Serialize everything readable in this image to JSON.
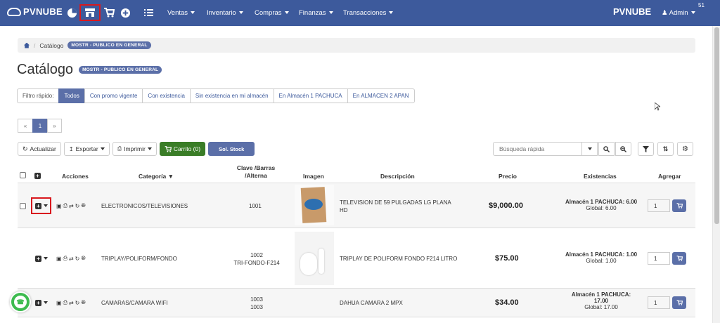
{
  "navbar": {
    "brand": "PVNUBE",
    "brand_right": "PVNUBE",
    "menus": [
      "Ventas",
      "Inventario",
      "Compras",
      "Finanzas",
      "Transacciones"
    ],
    "user": "Admin",
    "corner_number": "51",
    "icons": [
      "pie-chart-icon",
      "store-icon",
      "cart-icon",
      "plus-circle-icon",
      "list-icon"
    ]
  },
  "breadcrumb": {
    "current": "Catálogo",
    "badge": "MOSTR - PUBLICO EN GENERAL"
  },
  "page": {
    "title": "Catálogo",
    "badge": "MOSTR - PUBLICO EN GENERAL"
  },
  "filters": {
    "label": "Filtro rápido:",
    "options": [
      "Todos",
      "Con promo vigente",
      "Con existencia",
      "Sin existencia en mi almacén",
      "En Almacén 1 PACHUCA",
      "En ALMACEN 2 APAN"
    ],
    "active": "Todos"
  },
  "pager": {
    "prev": "«",
    "page": "1",
    "next": "»"
  },
  "toolbar": {
    "refresh": "Actualizar",
    "export": "Exportar",
    "print": "Imprimir",
    "cart": "Carrito (0)",
    "stock": "Sol. Stock",
    "search_placeholder": "Búsqueda rápida"
  },
  "table": {
    "headers": {
      "actions": "Acciones",
      "category": "Categoría",
      "code1": "Clave /Barras",
      "code2": "/Alterna",
      "image": "Imagen",
      "description": "Descripción",
      "price": "Precio",
      "stock": "Existencias",
      "add": "Agregar"
    },
    "rows": [
      {
        "category": "ELECTRONICOS/TELEVISIONES",
        "code": "1001",
        "code2": "",
        "description": "TELEVISION DE 59 PULGADAS LG PLANA",
        "description2": "HD",
        "price": "$9,000.00",
        "stock_main": "Almacén 1 PACHUCA: 6.00",
        "stock_global": "Global: 6.00",
        "qty": "1"
      },
      {
        "category": "TRIPLAY/POLIFORM/FONDO",
        "code": "1002",
        "code2": "TRI-FONDO-F214",
        "description": "TRIPLAY DE POLIFORM FONDO F214 LITRO",
        "description2": "",
        "price": "$75.00",
        "stock_main": "Almacén 1 PACHUCA: 1.00",
        "stock_global": "Global: 1.00",
        "qty": "1"
      },
      {
        "category": "CAMARAS/CAMARA WIFI",
        "code": "1003",
        "code2": "1003",
        "description": "DAHUA CAMARA 2 MPX",
        "description2": "",
        "price": "$34.00",
        "stock_main": "Almacén 1 PACHUCA:",
        "stock_main2": "17.00",
        "stock_global": "Global: 17.00",
        "qty": "1"
      }
    ]
  }
}
